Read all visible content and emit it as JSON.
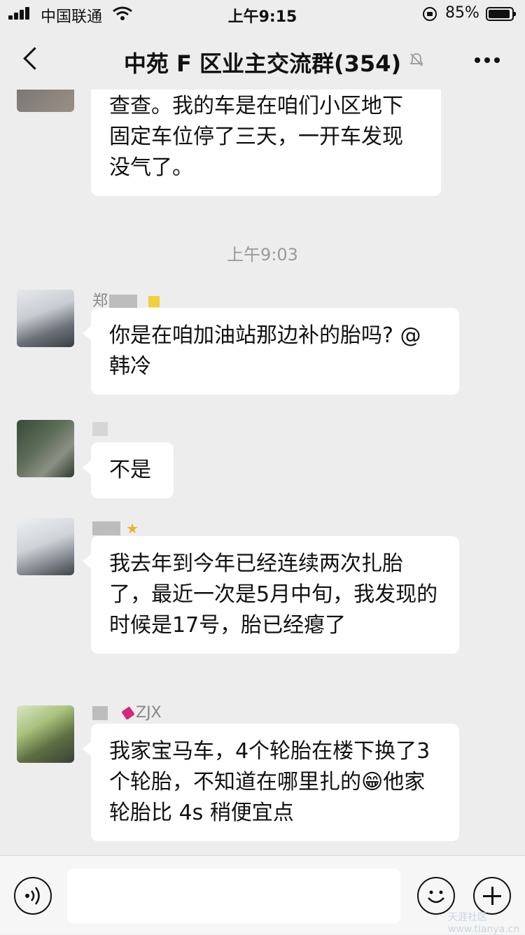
{
  "status_bar": {
    "carrier": "中国联通",
    "time": "上午9:15",
    "battery": "85%"
  },
  "header": {
    "title": "中苑 F 区业主交流群(354)"
  },
  "messages": [
    {
      "type": "text",
      "text": "大家要是再发现扎胎时，一定要查查。我的车是在咱们小区地下固定车位停了三天，一开车发现没气了。"
    },
    {
      "type": "timestamp",
      "text": "上午9:03"
    },
    {
      "type": "text",
      "sender": "郑",
      "text": "你是在咱加油站那边补的胎吗? @韩冷"
    },
    {
      "type": "text",
      "sender": "",
      "text": "不是"
    },
    {
      "type": "text",
      "sender": "",
      "text": "我去年到今年已经连续两次扎胎了，最近一次是5月中旬，我发现的时候是17号，胎已经瘪了"
    },
    {
      "type": "text",
      "sender": "ZJX",
      "text": "我家宝马车，4个轮胎在楼下换了3个轮胎，不知道在哪里扎的😁他家轮胎比 4s 稍便宜点"
    }
  ],
  "input_bar": {
    "placeholder": ""
  },
  "watermark": "天涯社区 www.tianya.cn",
  "colors": {
    "background": "#ededed",
    "bubble": "#ffffff",
    "text": "#111111",
    "muted": "#9a9a9a"
  },
  "icons": [
    "back-icon",
    "mute-icon",
    "more-icon",
    "voice-icon",
    "emoji-icon",
    "plus-icon"
  ]
}
